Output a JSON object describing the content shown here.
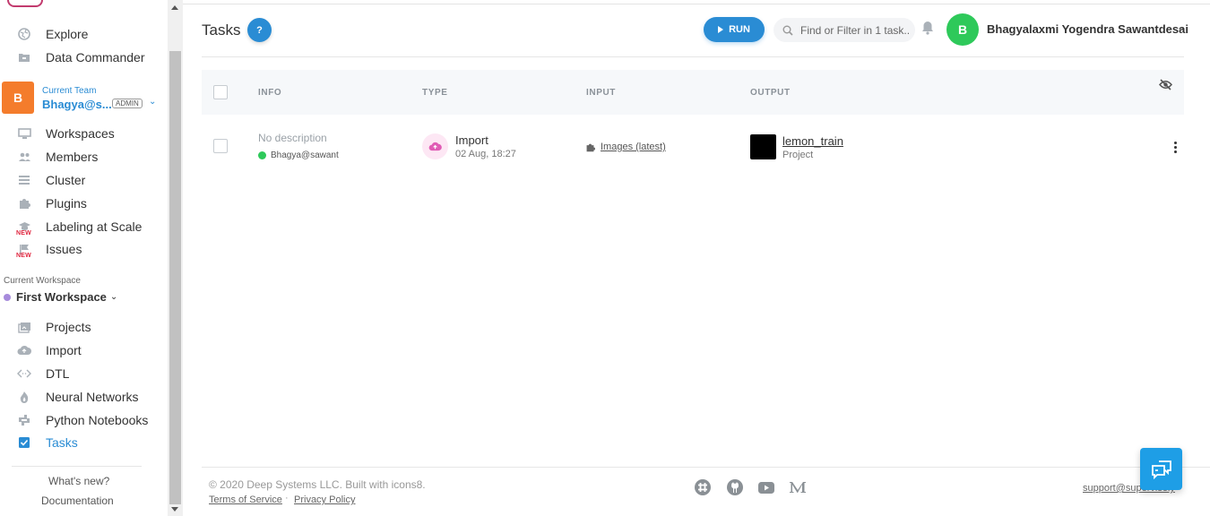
{
  "app": {
    "accent": "#2a8cd4"
  },
  "sidebar": {
    "top_items": [
      {
        "label": "Explore",
        "icon": "globe-icon"
      },
      {
        "label": "Data Commander",
        "icon": "folder-icon"
      }
    ],
    "team": {
      "avatar_letter": "B",
      "label": "Current Team",
      "name": "Bhagya@s...",
      "role": "ADMIN"
    },
    "team_items": [
      {
        "label": "Workspaces",
        "icon": "monitor-icon"
      },
      {
        "label": "Members",
        "icon": "users-icon"
      },
      {
        "label": "Cluster",
        "icon": "server-icon"
      },
      {
        "label": "Plugins",
        "icon": "puzzle-icon"
      },
      {
        "label": "Labeling at Scale",
        "icon": "graduation-icon",
        "badge": "NEW"
      },
      {
        "label": "Issues",
        "icon": "flag-icon",
        "badge": "NEW"
      }
    ],
    "workspace": {
      "label": "Current Workspace",
      "name": "First Workspace"
    },
    "workspace_items": [
      {
        "label": "Projects",
        "icon": "images-icon"
      },
      {
        "label": "Import",
        "icon": "cloud-upload-icon"
      },
      {
        "label": "DTL",
        "icon": "code-arrows-icon"
      },
      {
        "label": "Neural Networks",
        "icon": "flame-icon"
      },
      {
        "label": "Python Notebooks",
        "icon": "python-icon"
      },
      {
        "label": "Tasks",
        "icon": "checkbox-icon",
        "active": true
      }
    ],
    "whats_new": "What's new?",
    "documentation": "Documentation"
  },
  "header": {
    "title": "Tasks",
    "help": "?",
    "run": "RUN",
    "search_placeholder": "Find or Filter in 1 task..",
    "user_initial": "B",
    "user_name": "Bhagyalaxmi Yogendra Sawantdesai"
  },
  "table": {
    "columns": [
      "INFO",
      "TYPE",
      "INPUT",
      "OUTPUT"
    ],
    "rows": [
      {
        "description": "No description",
        "owner": "Bhagya@sawant",
        "type": "Import",
        "date": "02 Aug, 18:27",
        "input": "Images (latest)",
        "output_name": "lemon_train",
        "output_type": "Project"
      }
    ]
  },
  "footer": {
    "copyright": "© 2020 Deep Systems LLC. Built with icons8.",
    "terms": "Terms of Service",
    "separator": "·",
    "privacy": "Privacy Policy",
    "support": "support@supervisely",
    "social": [
      "slack-icon",
      "github-icon",
      "youtube-icon",
      "medium-icon"
    ]
  }
}
